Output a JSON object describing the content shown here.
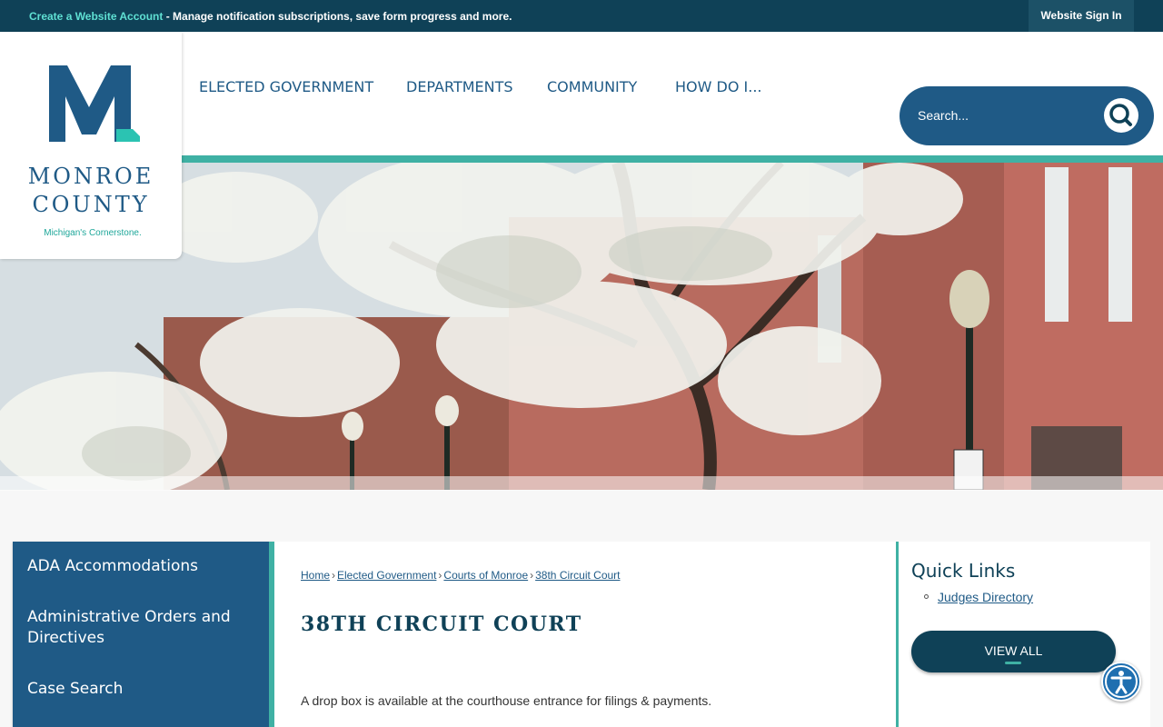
{
  "topbar": {
    "create_account_link": "Create a Website Account",
    "create_account_desc": " - Manage notification subscriptions, save form progress and more.",
    "sign_in_label": "Website Sign In"
  },
  "logo": {
    "line1": "MONROE",
    "line2": "COUNTY",
    "tagline": "Michigan's Cornerstone."
  },
  "nav": {
    "items": [
      "ELECTED GOVERNMENT",
      "DEPARTMENTS",
      "COMMUNITY",
      "HOW DO I..."
    ]
  },
  "search": {
    "placeholder": "Search..."
  },
  "sidebar": {
    "items": [
      "ADA Accommodations",
      "Administrative Orders and Directives",
      "Case Search"
    ]
  },
  "breadcrumb": {
    "items": [
      "Home",
      "Elected Government",
      "Courts of Monroe",
      "38th Circuit Court"
    ],
    "separator": "›"
  },
  "main": {
    "title": "38TH CIRCUIT COURT",
    "paragraph": "A drop box is available at the courthouse entrance for filings & payments."
  },
  "quick_links": {
    "heading": "Quick Links",
    "links": [
      "Judges Directory"
    ],
    "view_all_label": "VIEW ALL"
  },
  "colors": {
    "dark_teal": "#0f4157",
    "brand_blue": "#1f5a86",
    "accent_teal": "#3fb1a4"
  }
}
